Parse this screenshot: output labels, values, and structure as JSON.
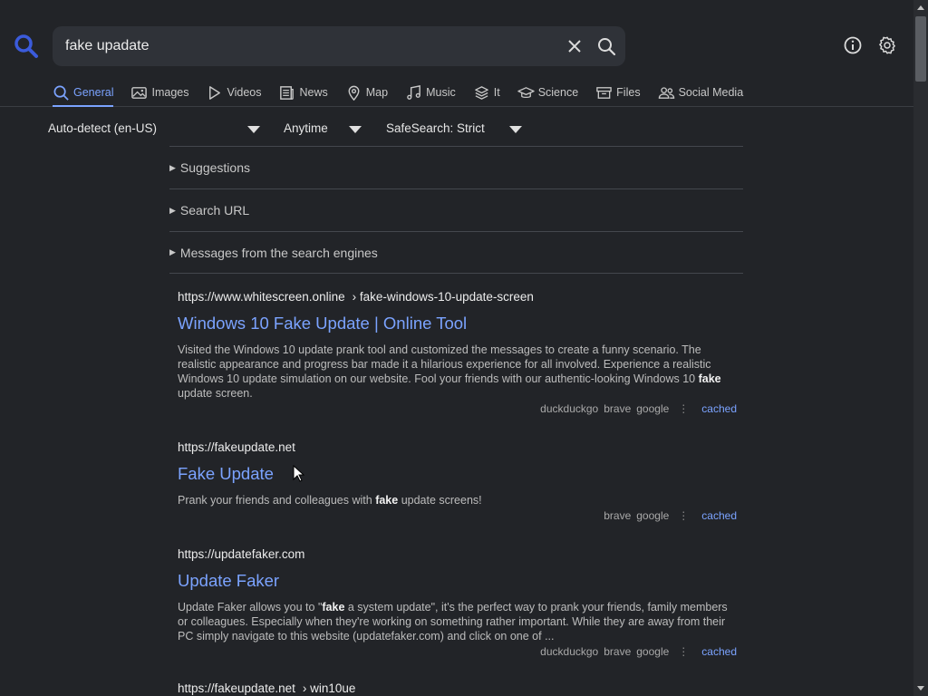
{
  "search": {
    "query": "fake upadate"
  },
  "header": {
    "logo_icon": "search-logo-icon",
    "info_icon": "info-icon",
    "settings_icon": "gear-icon"
  },
  "tabs": [
    {
      "label": "General",
      "icon": "search-icon",
      "active": true
    },
    {
      "label": "Images",
      "icon": "image-icon"
    },
    {
      "label": "Videos",
      "icon": "play-icon"
    },
    {
      "label": "News",
      "icon": "newspaper-icon"
    },
    {
      "label": "Map",
      "icon": "map-pin-icon"
    },
    {
      "label": "Music",
      "icon": "music-note-icon"
    },
    {
      "label": "It",
      "icon": "layers-icon"
    },
    {
      "label": "Science",
      "icon": "graduation-cap-icon"
    },
    {
      "label": "Files",
      "icon": "archive-icon"
    },
    {
      "label": "Social Media",
      "icon": "people-icon"
    }
  ],
  "filters": {
    "language": "Auto-detect (en-US)",
    "time": "Anytime",
    "safesearch": "SafeSearch: Strict"
  },
  "sections": [
    {
      "label": "Suggestions"
    },
    {
      "label": "Search URL"
    },
    {
      "label": "Messages from the search engines"
    }
  ],
  "results": [
    {
      "url": "https://www.whitescreen.online",
      "path": "› fake-windows-10-update-screen",
      "title": "Windows 10 Fake Update | Online Tool",
      "snippet": [
        {
          "t": "Visited the Windows 10 update prank tool and customized the messages to create a funny scenario. The realistic appearance and progress bar made it a hilarious experience for all involved. Experience a realistic Windows 10 update simulation on our website. Fool your friends with our authentic-looking Windows 10 "
        },
        {
          "t": "fake",
          "b": true
        },
        {
          "t": " update screen."
        }
      ],
      "engines": [
        "duckduckgo",
        "brave",
        "google"
      ],
      "cached": "cached"
    },
    {
      "url": "https://fakeupdate.net",
      "path": "",
      "title": "Fake Update",
      "snippet": [
        {
          "t": "Prank your friends and colleagues with "
        },
        {
          "t": "fake",
          "b": true
        },
        {
          "t": " update screens!"
        }
      ],
      "engines": [
        "brave",
        "google"
      ],
      "cached": "cached"
    },
    {
      "url": "https://updatefaker.com",
      "path": "",
      "title": "Update Faker",
      "snippet": [
        {
          "t": "Update Faker allows you to \""
        },
        {
          "t": "fake",
          "b": true
        },
        {
          "t": " a system update\", it's the perfect way to prank your friends, family members or colleagues. Especially when they're working on something rather important. While they are away from their PC simply navigate to this website (updatefaker.com) and click on one of ..."
        }
      ],
      "engines": [
        "duckduckgo",
        "brave",
        "google"
      ],
      "cached": "cached"
    },
    {
      "url": "https://fakeupdate.net",
      "path": "› win10ue",
      "title": "",
      "snippet": [],
      "engines": [],
      "cached": ""
    }
  ]
}
